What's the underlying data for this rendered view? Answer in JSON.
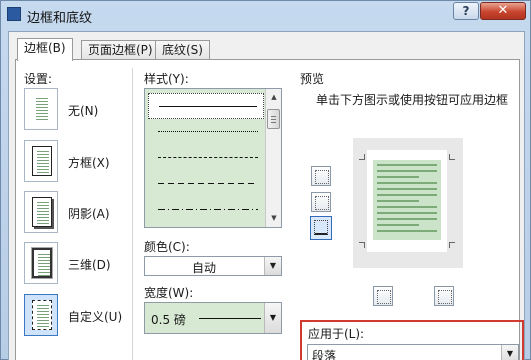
{
  "window": {
    "title": "边框和底纹",
    "help_label": "?",
    "close_label": "✕"
  },
  "tabs": [
    {
      "label": "边框(B)"
    },
    {
      "label": "页面边框(P)"
    },
    {
      "label": "底纹(S)"
    }
  ],
  "settings": {
    "label": "设置:",
    "items": [
      {
        "label": "无(N)",
        "icon": "none-border-icon"
      },
      {
        "label": "方框(X)",
        "icon": "box-border-icon"
      },
      {
        "label": "阴影(A)",
        "icon": "shadow-border-icon"
      },
      {
        "label": "三维(D)",
        "icon": "3d-border-icon"
      },
      {
        "label": "自定义(U)",
        "icon": "custom-border-icon"
      }
    ],
    "selected_index": 4
  },
  "style": {
    "label": "样式(Y):"
  },
  "color": {
    "label": "颜色(C):",
    "value": "自动"
  },
  "width": {
    "label": "宽度(W):",
    "value": "0.5 磅"
  },
  "preview": {
    "label": "预览",
    "instruction": "单击下方图示或使用按钮可应用边框"
  },
  "apply_to": {
    "label": "应用于(L):",
    "value": "段落"
  },
  "colors": {
    "accent_highlight": "#d23a2f",
    "list_bg": "#d7e9d3",
    "preview_text": "#cbe3c8"
  }
}
